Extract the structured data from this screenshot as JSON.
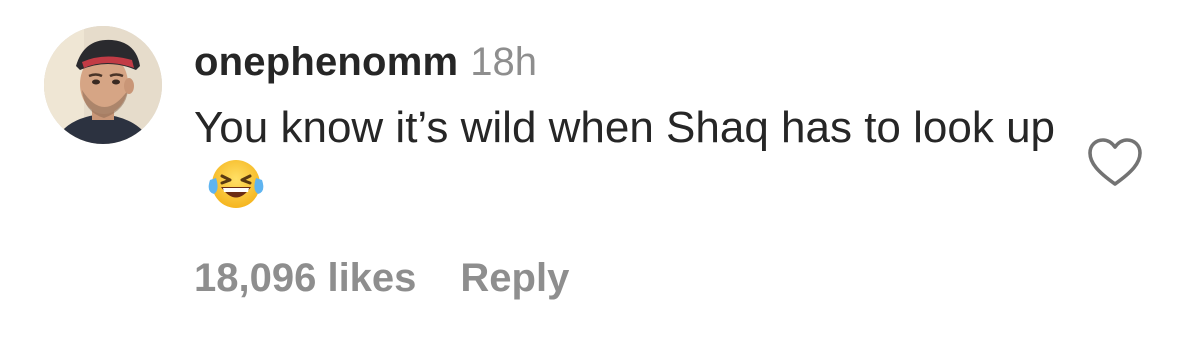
{
  "comment": {
    "username": "onephenomm",
    "timestamp": "18h",
    "text": "You know it’s wild when Shaq has to look up",
    "emoji": "face-with-tears-of-joy",
    "likes_label": "18,096 likes",
    "reply_label": "Reply",
    "like_icon": "heart-outline-icon",
    "colors": {
      "primary_text": "#262626",
      "secondary_text": "#8e8e8e",
      "background": "#ffffff"
    }
  }
}
